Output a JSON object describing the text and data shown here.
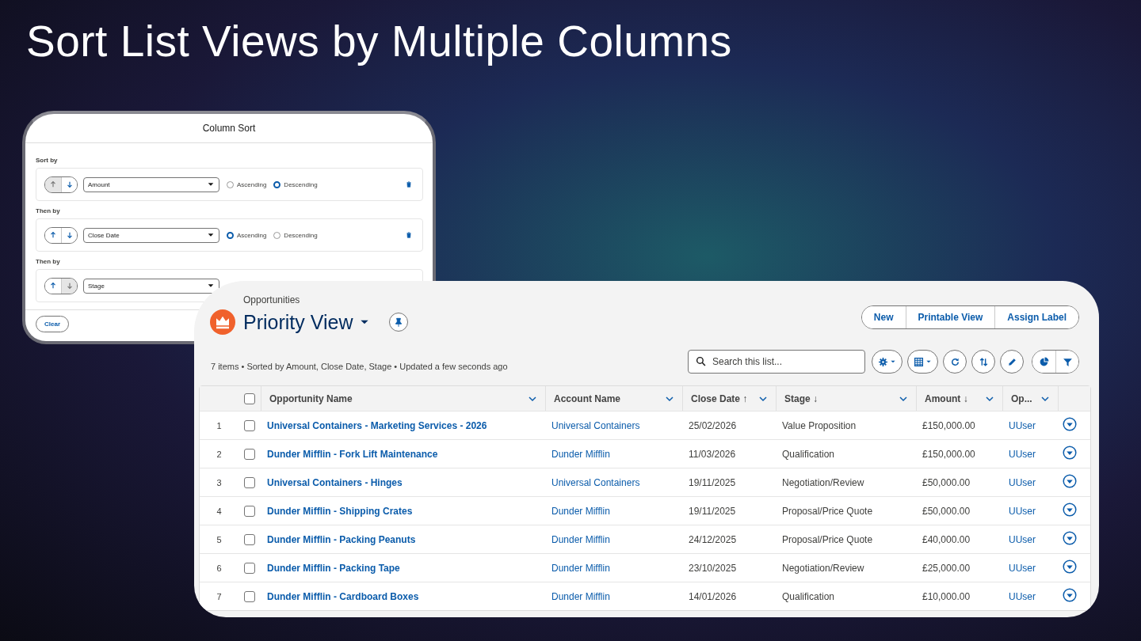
{
  "title": "Sort List Views by Multiple Columns",
  "column_sort": {
    "title": "Column Sort",
    "clear_button": "Clear",
    "sections": [
      {
        "label": "Sort by",
        "move_up": {
          "disabled": true
        },
        "move_down": {
          "disabled": false
        },
        "field": "Amount",
        "delete": true,
        "options": [
          {
            "label": "Ascending",
            "selected": false
          },
          {
            "label": "Descending",
            "selected": true
          }
        ]
      },
      {
        "label": "Then by",
        "move_up": {
          "disabled": false
        },
        "move_down": {
          "disabled": false
        },
        "field": "Close Date",
        "delete": true,
        "options": [
          {
            "label": "Ascending",
            "selected": true
          },
          {
            "label": "Descending",
            "selected": false
          }
        ]
      },
      {
        "label": "Then by",
        "move_up": {
          "disabled": false
        },
        "move_down": {
          "disabled": true
        },
        "field": "Stage",
        "delete": false
      }
    ]
  },
  "list_view": {
    "object": "Opportunities",
    "view_name": "Priority View",
    "buttons": [
      "New",
      "Printable View",
      "Assign Label"
    ],
    "status": "7 items • Sorted by Amount, Close Date, Stage • Updated a few seconds ago",
    "search": {
      "placeholder": "Search this list..."
    },
    "select_all": {
      "checked": false
    },
    "columns": [
      {
        "label": "Opportunity Name",
        "kind": "link"
      },
      {
        "label": "Account Name",
        "kind": "link"
      },
      {
        "label": "Close Date ↑",
        "kind": "text"
      },
      {
        "label": "Stage ↓",
        "kind": "text"
      },
      {
        "label": "Amount ↓",
        "kind": "text"
      },
      {
        "label": "Op...",
        "kind": "link"
      }
    ],
    "rows": [
      {
        "number": "1",
        "checked": false,
        "cells": [
          "Universal Containers - Marketing Services - 2026",
          "Universal Containers",
          "25/02/2026",
          "Value Proposition",
          "£150,000.00",
          "UUser"
        ]
      },
      {
        "number": "2",
        "checked": false,
        "cells": [
          "Dunder Mifflin - Fork Lift Maintenance",
          "Dunder Mifflin",
          "11/03/2026",
          "Qualification",
          "£150,000.00",
          "UUser"
        ]
      },
      {
        "number": "3",
        "checked": false,
        "cells": [
          "Universal Containers - Hinges",
          "Universal Containers",
          "19/11/2025",
          "Negotiation/Review",
          "£50,000.00",
          "UUser"
        ]
      },
      {
        "number": "4",
        "checked": false,
        "cells": [
          "Dunder Mifflin - Shipping Crates",
          "Dunder Mifflin",
          "19/11/2025",
          "Proposal/Price Quote",
          "£50,000.00",
          "UUser"
        ]
      },
      {
        "number": "5",
        "checked": false,
        "cells": [
          "Dunder Mifflin - Packing Peanuts",
          "Dunder Mifflin",
          "24/12/2025",
          "Proposal/Price Quote",
          "£40,000.00",
          "UUser"
        ]
      },
      {
        "number": "6",
        "checked": false,
        "cells": [
          "Dunder Mifflin - Packing Tape",
          "Dunder Mifflin",
          "23/10/2025",
          "Negotiation/Review",
          "£25,000.00",
          "UUser"
        ]
      },
      {
        "number": "7",
        "checked": false,
        "cells": [
          "Dunder Mifflin - Cardboard Boxes",
          "Dunder Mifflin",
          "14/01/2026",
          "Qualification",
          "£10,000.00",
          "UUser"
        ]
      }
    ]
  }
}
